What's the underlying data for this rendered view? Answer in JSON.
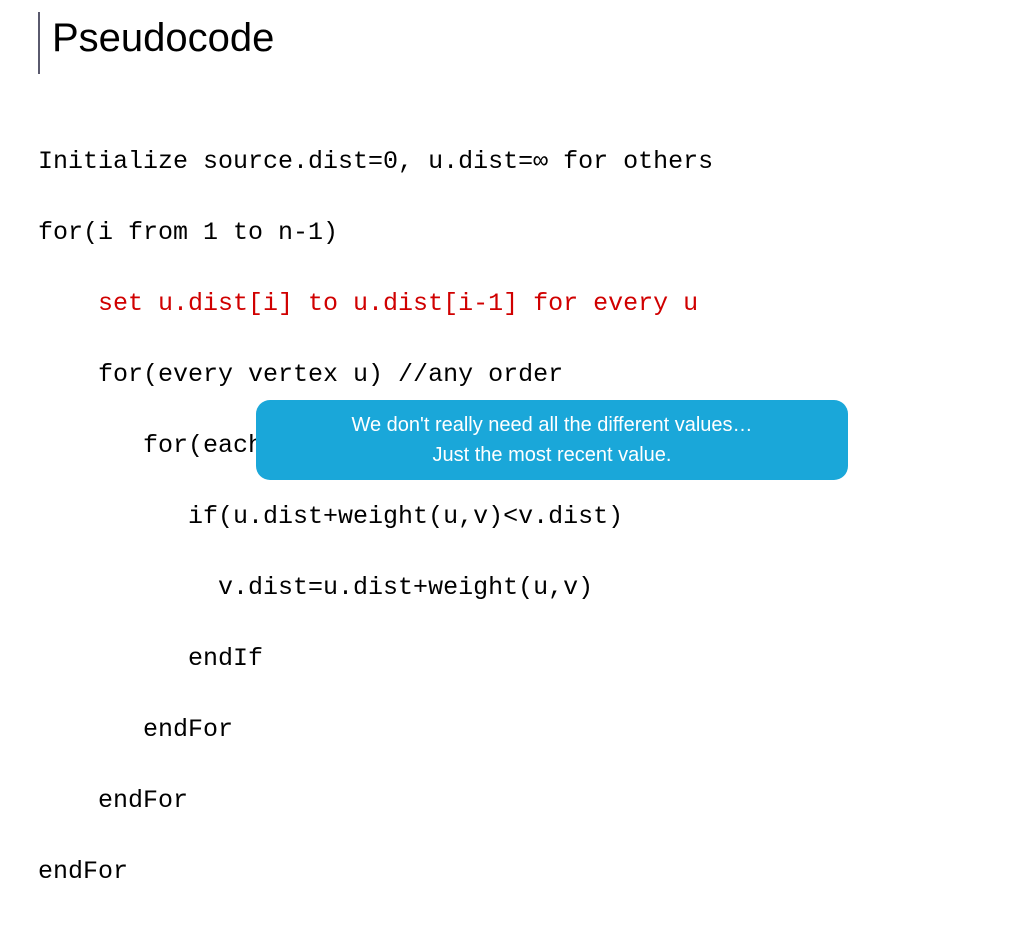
{
  "title": "Pseudocode",
  "code": {
    "l1": "Initialize source.dist=0, u.dist=∞ for others",
    "l2": "for(i from 1 to n-1)",
    "l3": "    set u.dist[i] to u.dist[i-1] for every u",
    "l4": "    for(every vertex u) //any order",
    "l5": "       for(each outgoing edge (u,v))//better!",
    "l6": "          if(u.dist+weight(u,v)<v.dist)",
    "l7": "            v.dist=u.dist+weight(u,v)",
    "l8": "          endIf",
    "l9": "       endFor",
    "l10": "    endFor",
    "l11": "endFor"
  },
  "callout": {
    "line1": "We don't really need all the different values…",
    "line2": "Just the most recent value."
  }
}
